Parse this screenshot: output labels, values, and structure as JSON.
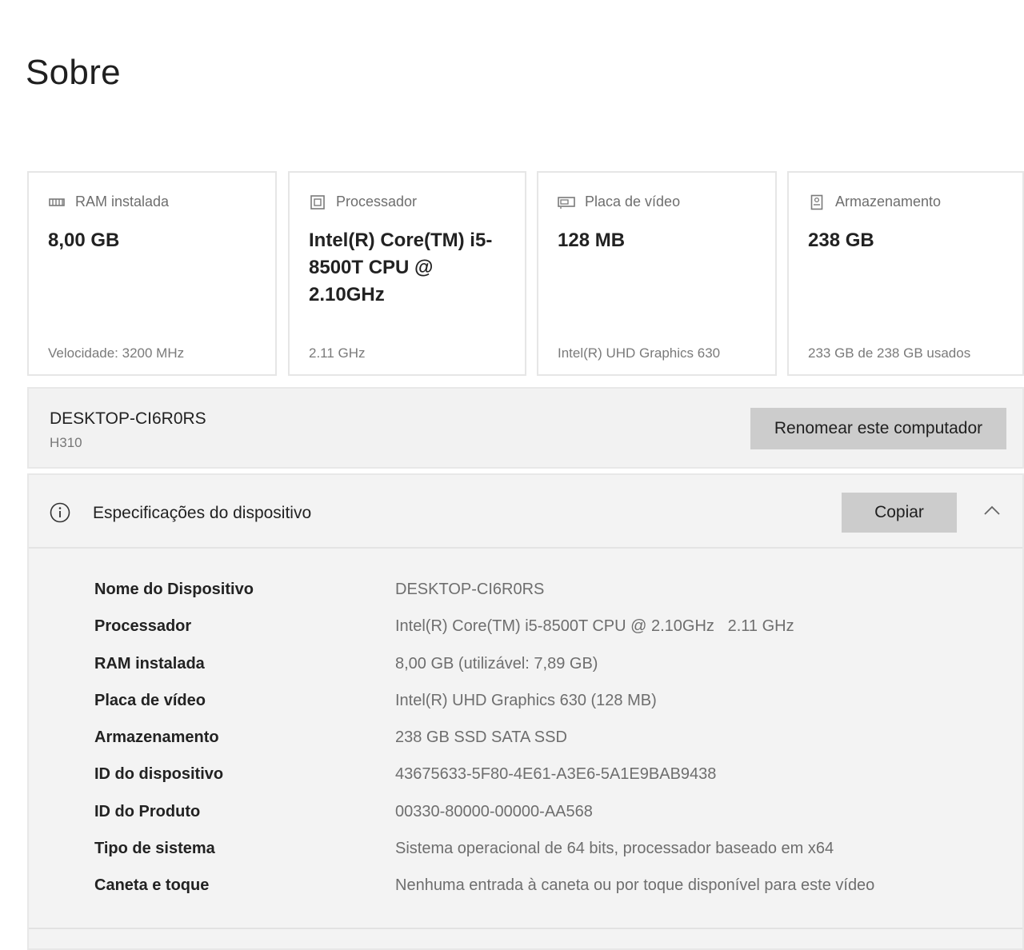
{
  "page": {
    "title": "Sobre"
  },
  "cards": [
    {
      "icon": "memory-icon",
      "label": "RAM instalada",
      "value": "8,00 GB",
      "foot": "Velocidade: 3200 MHz"
    },
    {
      "icon": "processor-icon",
      "label": "Processador",
      "value": "Intel(R) Core(TM) i5-8500T CPU @ 2.10GHz",
      "foot": "2.11 GHz"
    },
    {
      "icon": "gpu-icon",
      "label": "Placa de vídeo",
      "value": "128 MB",
      "foot": "Intel(R) UHD Graphics 630"
    },
    {
      "icon": "storage-icon",
      "label": "Armazenamento",
      "value": "238 GB",
      "foot": "233 GB de 238 GB usados"
    }
  ],
  "device": {
    "name": "DESKTOP-CI6R0RS",
    "model": "H310",
    "rename_label": "Renomear este computador"
  },
  "specs": {
    "title": "Especificações do dispositivo",
    "copy_label": "Copiar",
    "rows": [
      {
        "label": "Nome do Dispositivo",
        "value": "DESKTOP-CI6R0RS"
      },
      {
        "label": "Processador",
        "value": "Intel(R) Core(TM) i5-8500T CPU @ 2.10GHz   2.11 GHz"
      },
      {
        "label": "RAM instalada",
        "value": "8,00 GB (utilizável: 7,89 GB)"
      },
      {
        "label": "Placa de vídeo",
        "value": "Intel(R) UHD Graphics 630 (128 MB)"
      },
      {
        "label": "Armazenamento",
        "value": "238 GB SSD SATA SSD"
      },
      {
        "label": "ID do dispositivo",
        "value": "43675633-5F80-4E61-A3E6-5A1E9BAB9438"
      },
      {
        "label": "ID do Produto",
        "value": "00330-80000-00000-AA568"
      },
      {
        "label": "Tipo de sistema",
        "value": "Sistema operacional de 64 bits, processador baseado em x64"
      },
      {
        "label": "Caneta e toque",
        "value": "Nenhuma entrada à caneta ou por toque disponível para este vídeo"
      }
    ]
  }
}
